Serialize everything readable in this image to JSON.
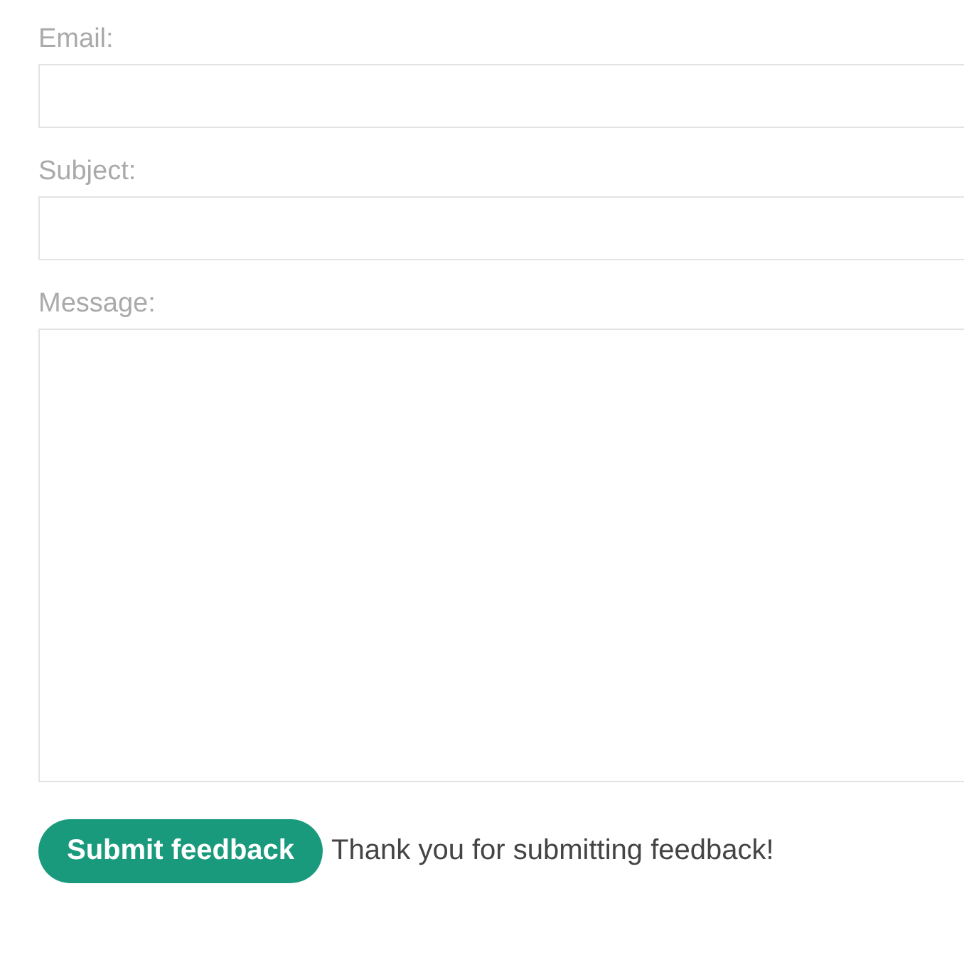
{
  "fields": [
    {
      "label": "Email:",
      "kind": "input"
    },
    {
      "label": "Subject:",
      "kind": "input"
    },
    {
      "label": "Message:",
      "kind": "textarea"
    }
  ],
  "submit_button": {
    "label": "Submit feedback"
  },
  "status_message": "Thank you for submitting feedback!"
}
